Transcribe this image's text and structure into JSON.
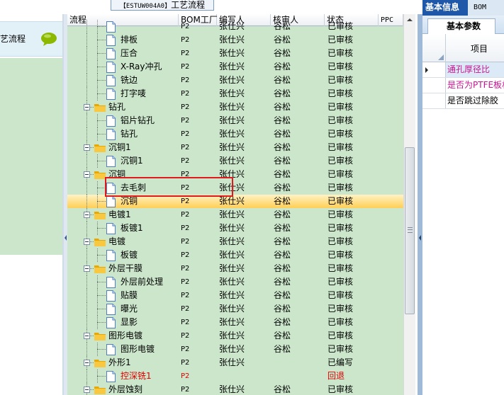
{
  "window": {
    "title_code": "【ESTUW004A0】",
    "title_text": "工艺流程"
  },
  "left_panel": {
    "item_label": "艺流程",
    "item_icon": "chat-bubble-icon"
  },
  "grid": {
    "columns": [
      "流程",
      "BOM工厂",
      "编写人",
      "核审人",
      "状态",
      "PPC"
    ],
    "rows": [
      {
        "label": "",
        "bom": "P2",
        "writer": "张仕兴",
        "reviewer": "谷松",
        "status": "已审核",
        "kind": "doc",
        "level": 2
      },
      {
        "label": "排板",
        "bom": "P2",
        "writer": "张仕兴",
        "reviewer": "谷松",
        "status": "已审核",
        "kind": "doc",
        "level": 2
      },
      {
        "label": "压合",
        "bom": "P2",
        "writer": "张仕兴",
        "reviewer": "谷松",
        "status": "已审核",
        "kind": "doc",
        "level": 2
      },
      {
        "label": "X-Ray冲孔",
        "bom": "P2",
        "writer": "张仕兴",
        "reviewer": "谷松",
        "status": "已审核",
        "kind": "doc",
        "level": 2
      },
      {
        "label": "铣边",
        "bom": "P2",
        "writer": "张仕兴",
        "reviewer": "谷松",
        "status": "已审核",
        "kind": "doc",
        "level": 2
      },
      {
        "label": "打字唛",
        "bom": "P2",
        "writer": "张仕兴",
        "reviewer": "谷松",
        "status": "已审核",
        "kind": "doc",
        "level": 2
      },
      {
        "label": "钻孔",
        "bom": "P2",
        "writer": "张仕兴",
        "reviewer": "谷松",
        "status": "已审核",
        "kind": "folder",
        "level": 1
      },
      {
        "label": "铝片钻孔",
        "bom": "P2",
        "writer": "张仕兴",
        "reviewer": "谷松",
        "status": "已审核",
        "kind": "doc",
        "level": 2
      },
      {
        "label": "钻孔",
        "bom": "P2",
        "writer": "张仕兴",
        "reviewer": "谷松",
        "status": "已审核",
        "kind": "doc",
        "level": 2
      },
      {
        "label": "沉铜1",
        "bom": "P2",
        "writer": "张仕兴",
        "reviewer": "谷松",
        "status": "已审核",
        "kind": "folder",
        "level": 1
      },
      {
        "label": "沉铜1",
        "bom": "P2",
        "writer": "张仕兴",
        "reviewer": "谷松",
        "status": "已审核",
        "kind": "doc",
        "level": 2
      },
      {
        "label": "沉铜",
        "bom": "P2",
        "writer": "张仕兴",
        "reviewer": "谷松",
        "status": "已审核",
        "kind": "folder",
        "level": 1
      },
      {
        "label": "去毛刺",
        "bom": "P2",
        "writer": "张仕兴",
        "reviewer": "谷松",
        "status": "已审核",
        "kind": "doc",
        "level": 2
      },
      {
        "label": "沉铜",
        "bom": "P2",
        "writer": "张仕兴",
        "reviewer": "谷松",
        "status": "已审核",
        "kind": "doc",
        "level": 2,
        "selected": true
      },
      {
        "label": "电镀1",
        "bom": "P2",
        "writer": "张仕兴",
        "reviewer": "谷松",
        "status": "已审核",
        "kind": "folder",
        "level": 1
      },
      {
        "label": "板镀1",
        "bom": "P2",
        "writer": "张仕兴",
        "reviewer": "谷松",
        "status": "已审核",
        "kind": "doc",
        "level": 2
      },
      {
        "label": "电镀",
        "bom": "P2",
        "writer": "张仕兴",
        "reviewer": "谷松",
        "status": "已审核",
        "kind": "folder",
        "level": 1
      },
      {
        "label": "板镀",
        "bom": "P2",
        "writer": "张仕兴",
        "reviewer": "谷松",
        "status": "已审核",
        "kind": "doc",
        "level": 2
      },
      {
        "label": "外层干膜",
        "bom": "P2",
        "writer": "张仕兴",
        "reviewer": "谷松",
        "status": "已审核",
        "kind": "folder",
        "level": 1
      },
      {
        "label": "外层前处理",
        "bom": "P2",
        "writer": "张仕兴",
        "reviewer": "谷松",
        "status": "已审核",
        "kind": "doc",
        "level": 2
      },
      {
        "label": "贴膜",
        "bom": "P2",
        "writer": "张仕兴",
        "reviewer": "谷松",
        "status": "已审核",
        "kind": "doc",
        "level": 2
      },
      {
        "label": "曝光",
        "bom": "P2",
        "writer": "张仕兴",
        "reviewer": "谷松",
        "status": "已审核",
        "kind": "doc",
        "level": 2
      },
      {
        "label": "显影",
        "bom": "P2",
        "writer": "张仕兴",
        "reviewer": "谷松",
        "status": "已审核",
        "kind": "doc",
        "level": 2
      },
      {
        "label": "图形电镀",
        "bom": "P2",
        "writer": "张仕兴",
        "reviewer": "谷松",
        "status": "已审核",
        "kind": "folder",
        "level": 1
      },
      {
        "label": "图形电镀",
        "bom": "P2",
        "writer": "张仕兴",
        "reviewer": "谷松",
        "status": "已审核",
        "kind": "doc",
        "level": 2
      },
      {
        "label": "外形1",
        "bom": "P2",
        "writer": "张仕兴",
        "reviewer": "",
        "status": "已编写",
        "kind": "folder",
        "level": 1
      },
      {
        "label": "控深铣1",
        "bom": "P2",
        "writer": "",
        "reviewer": "",
        "status": "回退",
        "kind": "doc",
        "level": 2,
        "red": true
      },
      {
        "label": "外层蚀刻",
        "bom": "P2",
        "writer": "张仕兴",
        "reviewer": "谷松",
        "status": "已审核",
        "kind": "folder",
        "level": 1
      }
    ]
  },
  "right_panel": {
    "tabs": [
      "基本信息",
      "BOM"
    ],
    "subtab": "基本参数",
    "column_header": "项目",
    "rows": [
      {
        "label": "通孔厚径比",
        "selected": true
      },
      {
        "label": "是否为PTFE板材",
        "pink": true
      },
      {
        "label": "是否跳过除胶"
      }
    ]
  },
  "colors": {
    "grid_background": "#cbe6cb",
    "selected_row": "#ffcf57",
    "highlight_box": "#e0191c",
    "returned_status": "#e00000",
    "tab_active": "#1f58a8"
  }
}
